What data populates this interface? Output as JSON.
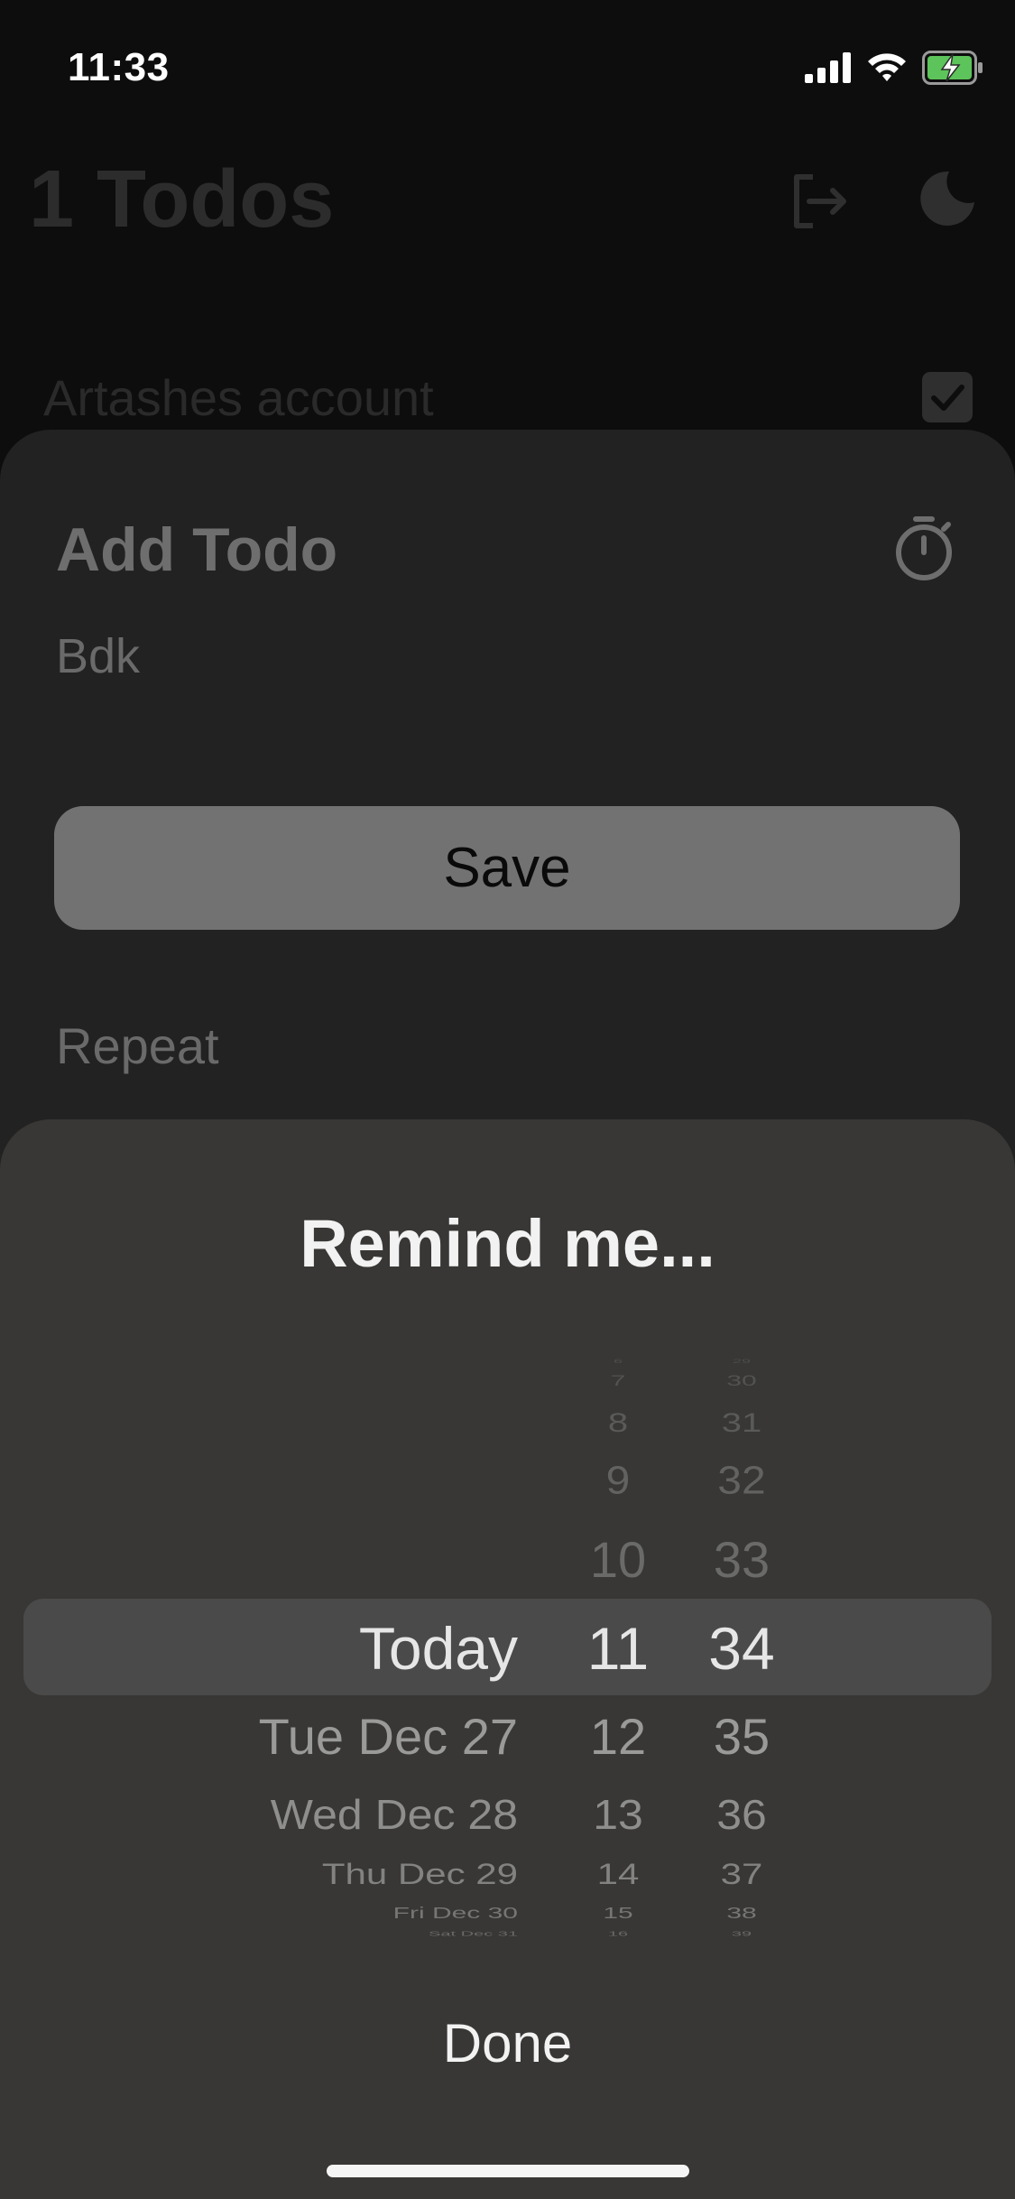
{
  "status_bar": {
    "time": "11:33"
  },
  "background": {
    "title": "1 Todos",
    "item_text": "Artashes account"
  },
  "add_todo": {
    "title": "Add Todo",
    "todo_text": "Bdk",
    "save_label": "Save",
    "repeat_label": "Repeat"
  },
  "remind": {
    "title": "Remind me...",
    "done_label": "Done",
    "dates": [
      "Today",
      "Tue Dec 27",
      "Wed Dec 28",
      "Thu Dec 29",
      "Fri Dec 30",
      "Sat Dec 31"
    ],
    "hours": [
      "6",
      "7",
      "8",
      "9",
      "10",
      "11",
      "12",
      "13",
      "14",
      "15",
      "16"
    ],
    "minutes": [
      "29",
      "30",
      "31",
      "32",
      "33",
      "34",
      "35",
      "36",
      "37",
      "38",
      "39"
    ]
  },
  "colors": {
    "battery_fill": "#5cc45a",
    "sheet_bg": "#222222",
    "remind_bg": "#383735",
    "save_button_bg": "#727272"
  }
}
